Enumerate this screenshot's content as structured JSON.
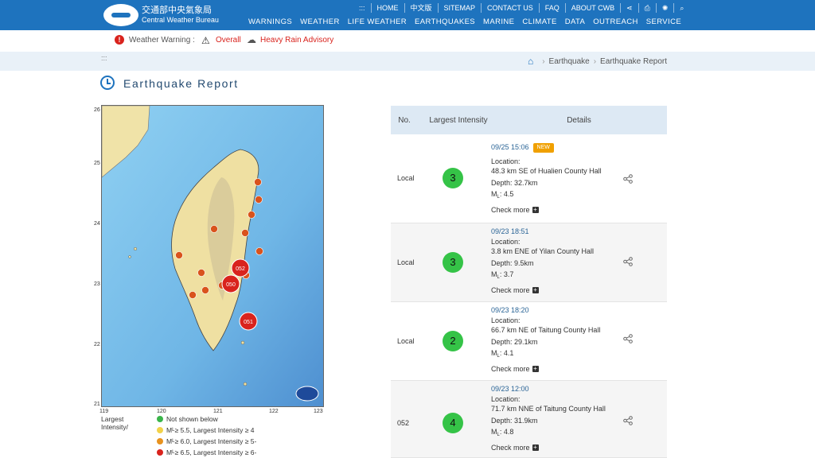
{
  "brand": {
    "name_cn": "交通部中央氣象局",
    "name_en": "Central Weather Bureau"
  },
  "util_nav": [
    ":::",
    "HOME",
    "中文版",
    "SITEMAP",
    "CONTACT US",
    "FAQ",
    "ABOUT CWB",
    "share-icon",
    "print-icon",
    "gear-icon",
    "search-icon"
  ],
  "util_labels": {
    "dots": ":::",
    "home": "HOME",
    "zh": "中文版",
    "sitemap": "SITEMAP",
    "contact": "CONTACT US",
    "faq": "FAQ",
    "about": "ABOUT CWB"
  },
  "main_nav": [
    "WARNINGS",
    "WEATHER",
    "LIFE WEATHER",
    "EARTHQUAKES",
    "MARINE",
    "CLIMATE",
    "DATA",
    "OUTREACH",
    "SERVICE"
  ],
  "warning": {
    "label": "Weather Warning :",
    "overall": "Overall",
    "advisory": "Heavy Rain Advisory"
  },
  "breadcrumb": {
    "dots": ":::",
    "items": [
      "Earthquake",
      "Earthquake Report"
    ]
  },
  "page_title": "Earthquake Report",
  "map": {
    "lat_ticks": [
      "26",
      "25",
      "24",
      "23",
      "22",
      "21"
    ],
    "lon_ticks": [
      "119",
      "120",
      "121",
      "122",
      "123"
    ],
    "markers": [
      "052",
      "050",
      "051"
    ]
  },
  "legend": {
    "title": "Largest Intensity/",
    "rows": [
      {
        "text": "Not shown below",
        "color": "#3ab54a"
      },
      {
        "ml": "M",
        "sub": "L",
        "rest": " ≥ 5.5, Largest Intensity ≥ 4",
        "color": "#f2d24a"
      },
      {
        "ml": "M",
        "sub": "L",
        "rest": " ≥ 6.0, Largest Intensity ≥ 5-",
        "color": "#e8921e"
      },
      {
        "ml": "M",
        "sub": "L",
        "rest": " ≥ 6.5, Largest Intensity ≥ 6-",
        "color": "#d9231d"
      }
    ]
  },
  "table": {
    "headers": {
      "no": "No.",
      "intensity": "Largest Intensity",
      "details": "Details"
    },
    "rows": [
      {
        "no": "Local",
        "intensity": "3",
        "date": "09/25 15:06",
        "badge": "NEW",
        "location_label": "Location:",
        "location": "48.3 km SE of Hualien County Hall",
        "depth": "Depth: 32.7km",
        "ml_prefix": "M",
        "ml_sub": "L",
        "ml": ": 4.5",
        "more": "Check more"
      },
      {
        "no": "Local",
        "intensity": "3",
        "date": "09/23 18:51",
        "location_label": "Location:",
        "location": "3.8 km ENE of Yilan County Hall",
        "depth": "Depth: 9.5km",
        "ml_prefix": "M",
        "ml_sub": "L",
        "ml": ": 3.7",
        "more": "Check more"
      },
      {
        "no": "Local",
        "intensity": "2",
        "date": "09/23 18:20",
        "location_label": "Location:",
        "location": "66.7 km NE of Taitung County Hall",
        "depth": "Depth: 29.1km",
        "ml_prefix": "M",
        "ml_sub": "L",
        "ml": ": 4.1",
        "more": "Check more"
      },
      {
        "no": "052",
        "intensity": "4",
        "date": "09/23 12:00",
        "location_label": "Location:",
        "location": "71.7 km NNE of Taitung County Hall",
        "depth": "Depth: 31.9km",
        "ml_prefix": "M",
        "ml_sub": "L",
        "ml": ": 4.8",
        "more": "Check more"
      }
    ]
  },
  "colors": {
    "brand_blue": "#1e73be",
    "warn_red": "#d9231d",
    "intensity_green": "#35c347",
    "new_orange": "#f0a000"
  }
}
